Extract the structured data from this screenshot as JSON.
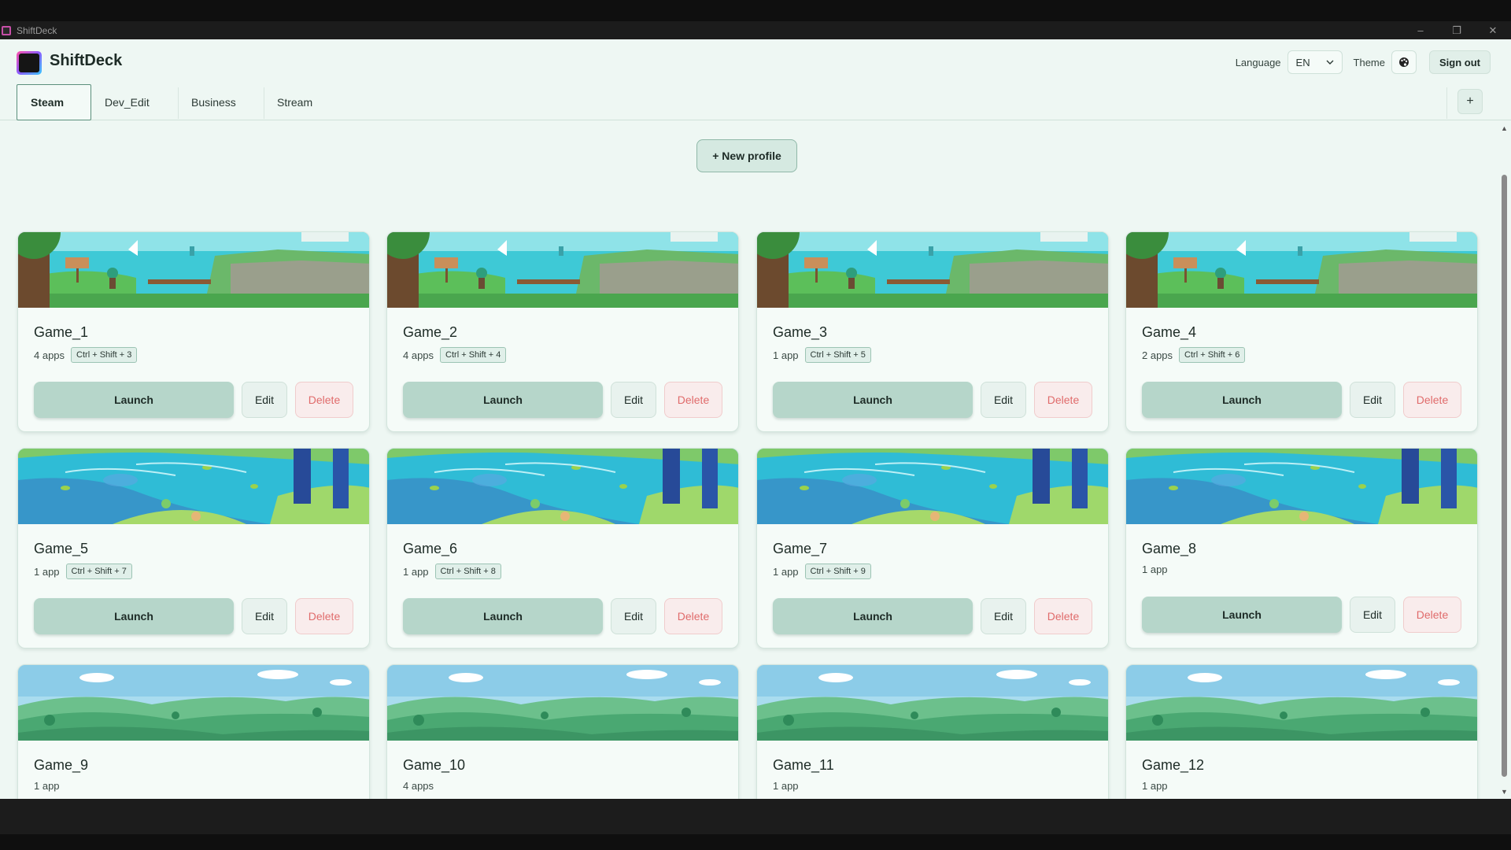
{
  "window": {
    "title": "ShiftDeck"
  },
  "header": {
    "brand": "ShiftDeck",
    "language_label": "Language",
    "language_value": "EN",
    "theme_label": "Theme",
    "sign_out": "Sign out"
  },
  "tabs": [
    {
      "label": "Steam",
      "active": true
    },
    {
      "label": "Dev_Edit",
      "active": false
    },
    {
      "label": "Business",
      "active": false
    },
    {
      "label": "Stream",
      "active": false
    }
  ],
  "add_tab": "+",
  "new_profile": "+ New profile",
  "buttons": {
    "launch": "Launch",
    "edit": "Edit",
    "delete": "Delete"
  },
  "cards": [
    {
      "title": "Game_1",
      "apps": "4 apps",
      "hotkey": "Ctrl + Shift + 3",
      "banner": "lake"
    },
    {
      "title": "Game_2",
      "apps": "4 apps",
      "hotkey": "Ctrl + Shift + 4",
      "banner": "lake"
    },
    {
      "title": "Game_3",
      "apps": "1 app",
      "hotkey": "Ctrl + Shift + 5",
      "banner": "lake"
    },
    {
      "title": "Game_4",
      "apps": "2 apps",
      "hotkey": "Ctrl + Shift + 6",
      "banner": "lake"
    },
    {
      "title": "Game_5",
      "apps": "1 app",
      "hotkey": "Ctrl + Shift + 7",
      "banner": "river"
    },
    {
      "title": "Game_6",
      "apps": "1 app",
      "hotkey": "Ctrl + Shift + 8",
      "banner": "river"
    },
    {
      "title": "Game_7",
      "apps": "1 app",
      "hotkey": "Ctrl + Shift + 9",
      "banner": "river"
    },
    {
      "title": "Game_8",
      "apps": "1 app",
      "hotkey": "",
      "banner": "river"
    },
    {
      "title": "Game_9",
      "apps": "1 app",
      "hotkey": "",
      "banner": "hills"
    },
    {
      "title": "Game_10",
      "apps": "4 apps",
      "hotkey": "",
      "banner": "hills"
    },
    {
      "title": "Game_11",
      "apps": "1 app",
      "hotkey": "",
      "banner": "hills"
    },
    {
      "title": "Game_12",
      "apps": "1 app",
      "hotkey": "",
      "banner": "hills"
    }
  ],
  "colors": {
    "accent": "#b6d6ca",
    "background": "#eef7f3",
    "danger": "#e06b6b"
  }
}
